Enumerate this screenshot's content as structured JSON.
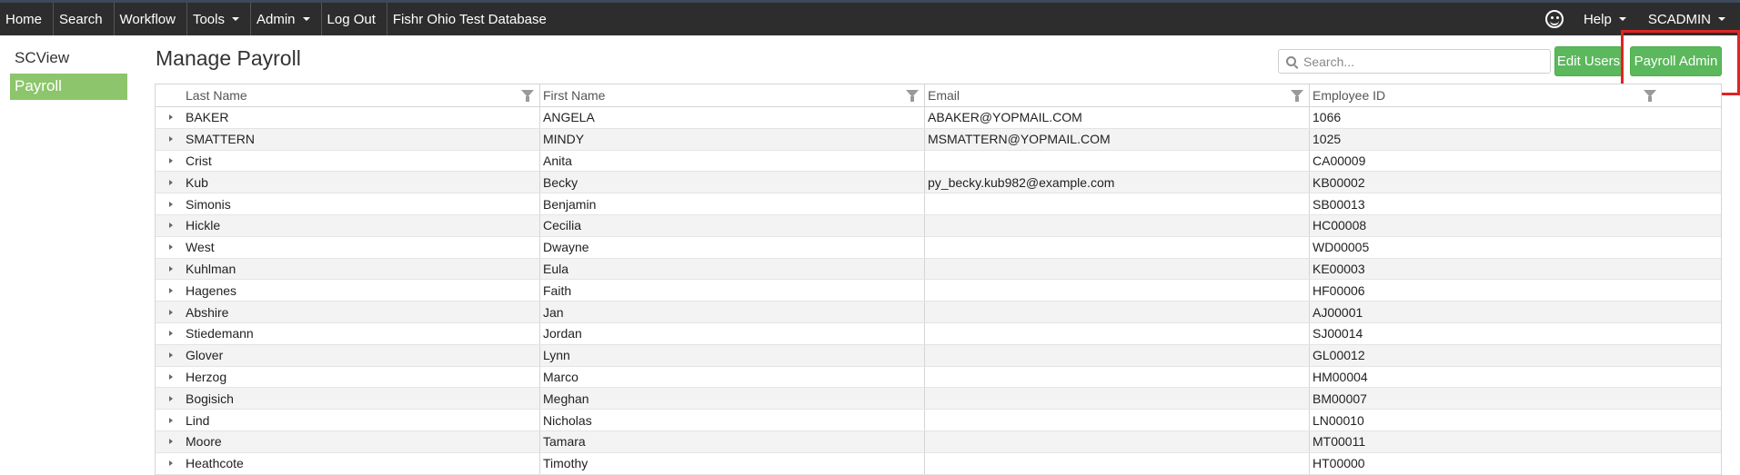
{
  "navbar": {
    "items": [
      "Home",
      "Search",
      "Workflow",
      "Tools",
      "Admin",
      "Log Out"
    ],
    "db_name": "Fishr Ohio Test Database",
    "help": "Help",
    "user": "SCADMIN"
  },
  "sidebar": {
    "items": [
      "SCView",
      "Payroll"
    ],
    "active_index": 1
  },
  "page": {
    "title": "Manage Payroll",
    "search_placeholder": "Search...",
    "edit_users_label": "Edit Users",
    "payroll_admin_label": "Payroll Admin"
  },
  "table": {
    "columns": [
      "Last Name",
      "First Name",
      "Email",
      "Employee ID"
    ],
    "rows": [
      [
        "BAKER",
        "ANGELA",
        "ABAKER@YOPMAIL.COM",
        "1066"
      ],
      [
        "SMATTERN",
        "MINDY",
        "MSMATTERN@YOPMAIL.COM",
        "1025"
      ],
      [
        "Crist",
        "Anita",
        "",
        "CA00009"
      ],
      [
        "Kub",
        "Becky",
        "py_becky.kub982@example.com",
        "KB00002"
      ],
      [
        "Simonis",
        "Benjamin",
        "",
        "SB00013"
      ],
      [
        "Hickle",
        "Cecilia",
        "",
        "HC00008"
      ],
      [
        "West",
        "Dwayne",
        "",
        "WD00005"
      ],
      [
        "Kuhlman",
        "Eula",
        "",
        "KE00003"
      ],
      [
        "Hagenes",
        "Faith",
        "",
        "HF00006"
      ],
      [
        "Abshire",
        "Jan",
        "",
        "AJ00001"
      ],
      [
        "Stiedemann",
        "Jordan",
        "",
        "SJ00014"
      ],
      [
        "Glover",
        "Lynn",
        "",
        "GL00012"
      ],
      [
        "Herzog",
        "Marco",
        "",
        "HM00004"
      ],
      [
        "Bogisich",
        "Meghan",
        "",
        "BM00007"
      ],
      [
        "Lind",
        "Nicholas",
        "",
        "LN00010"
      ],
      [
        "Moore",
        "Tamara",
        "",
        "MT00011"
      ],
      [
        "Heathcote",
        "Timothy",
        "",
        "HT00000"
      ]
    ]
  },
  "colors": {
    "navbar_bg": "#2d2d2d",
    "accent_green": "#5cb85c",
    "sidebar_active": "#8cc56b",
    "highlight_red": "#e02424"
  }
}
